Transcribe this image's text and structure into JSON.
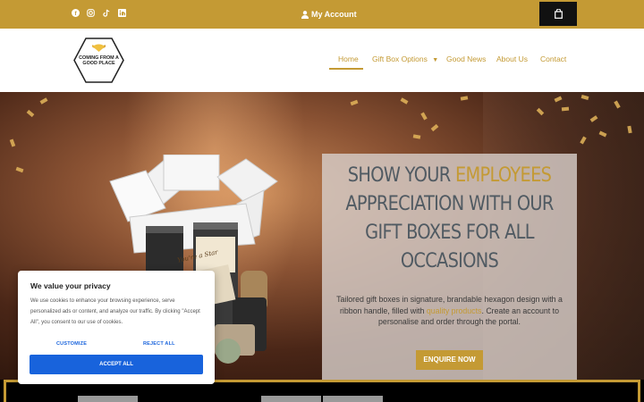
{
  "topbar": {
    "social": [
      "facebook-icon",
      "instagram-icon",
      "tiktok-icon",
      "linkedin-icon"
    ],
    "account_label": "My Account",
    "background": "#c49a34"
  },
  "logo": {
    "text": "COMING FROM A GOOD PLACE"
  },
  "nav": {
    "items": [
      "Home",
      "Gift Box Options",
      "Good News",
      "About Us",
      "Contact"
    ],
    "dropdown_icon": "caret-down-icon"
  },
  "hero": {
    "headline_part1": "SHOW YOUR ",
    "headline_accent": "EMPLOYEES",
    "headline_part2": "APPRECIATION WITH OUR GIFT BOXES FOR ALL OCCASIONS",
    "desc_before": "Tailored gift boxes in signature, brandable hexagon design with a ribbon handle, filled with ",
    "desc_link": "quality products",
    "desc_after": ". Create an account to personalise and order through the portal.",
    "cta": "ENQUIRE NOW",
    "tag_text": "You're a Star"
  },
  "cookie": {
    "title": "We value your privacy",
    "text": "We use cookies to enhance your browsing experience, serve personalized ads or content, and analyze our traffic. By clicking \"Accept All\", you consent to our use of cookies.",
    "customize": "CUSTOMIZE",
    "reject": "REJECT ALL",
    "accept": "ACCEPT ALL"
  },
  "colors": {
    "gold": "#c49a34",
    "blue": "#1863dc"
  }
}
